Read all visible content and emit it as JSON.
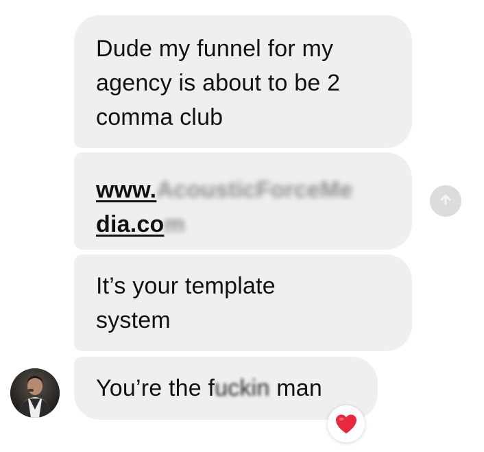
{
  "conversation": {
    "messages": [
      {
        "lines": [
          "Dude my funnel for my",
          "agency is about to be 2",
          "comma club"
        ]
      },
      {
        "link_line1_prefix": "www.",
        "link_line1_blurred": "AcousticForceMe",
        "link_line2_prefix": "dia.co",
        "link_line2_blurred": "m"
      },
      {
        "lines": [
          "It’s your template",
          "system"
        ]
      },
      {
        "text_before": "You’re the f",
        "text_blurred": "uckin",
        "text_after": " man"
      }
    ],
    "reaction": {
      "emoji": "❤️",
      "icon": "heart-icon"
    },
    "side_action_icon": "share-icon"
  },
  "colors": {
    "bubble": "#efefef",
    "text": "#111111",
    "heart": "#e8283d"
  }
}
